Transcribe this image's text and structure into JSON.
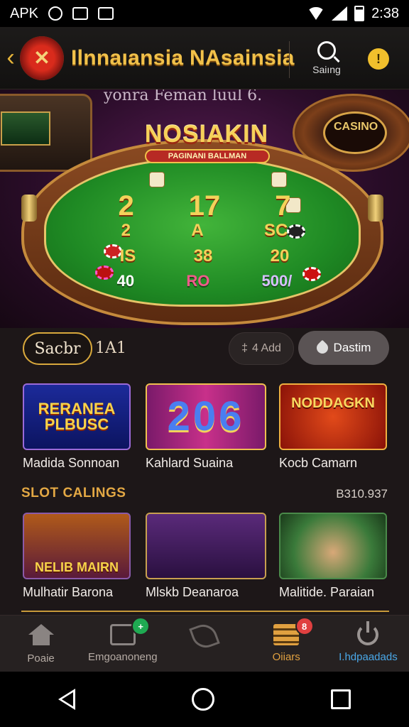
{
  "status": {
    "left_text": "APK",
    "time": "2:38"
  },
  "header": {
    "title": "Ilnnaıansia NAsainsia",
    "search_label": "Saiıng",
    "coin_label": "!"
  },
  "hero": {
    "caption": "yonra Feman luul 6.",
    "table_title": "NOSIAKIN",
    "table_subtitle": "PAGINANI BALLMAN",
    "right_machine_text": "CASINO",
    "bets": {
      "row1": [
        "2",
        "17",
        "7"
      ],
      "row2": [
        "2",
        "A",
        "SC"
      ],
      "row3": [
        "IS",
        "38",
        "20"
      ],
      "row4": [
        "40",
        "RO",
        "500/"
      ]
    }
  },
  "filters": {
    "chip_label": "Sacbr",
    "extra_label": "1A1",
    "add_label": "4 Add",
    "destin_label": "Dastim"
  },
  "games_row1": [
    {
      "thumb_text": "RERANEA PLBUSC",
      "title": "Madida Sonnoan"
    },
    {
      "thumb_text": "206",
      "title": "Kahlard Suaina"
    },
    {
      "thumb_text": "NODDAGKN",
      "title": "Kocb Camarn"
    }
  ],
  "section": {
    "title": "SLOT CALINGS",
    "count": "B310.937"
  },
  "games_row2": [
    {
      "thumb_text": "NELIB MAIRN",
      "title": "Mulhatir Barona"
    },
    {
      "thumb_text": "",
      "title": "Mlskb Deanaroa"
    },
    {
      "thumb_text": "",
      "title": "Malitide. Paraian"
    }
  ],
  "bottom_nav": [
    {
      "label": "Poaie",
      "icon": "home-icon"
    },
    {
      "label": "Emgoanoneng",
      "icon": "tv-icon",
      "badge": "+"
    },
    {
      "label": "",
      "icon": "leaf-icon"
    },
    {
      "label": "Oiiars",
      "icon": "cards-icon",
      "badge": "8"
    },
    {
      "label": "I.hdpaadads",
      "icon": "power-icon"
    }
  ],
  "colors": {
    "accent": "#f1c14a",
    "active": "#4aa8e8",
    "background": "#1d1718"
  }
}
